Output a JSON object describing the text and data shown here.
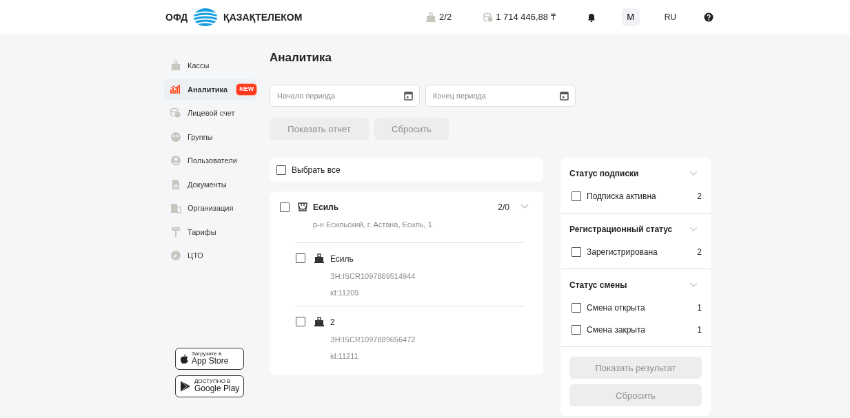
{
  "header": {
    "logo_prefix": "ОФД",
    "logo_brand": "ҚАЗАҚТЕЛЕКОМ",
    "kkm_count": "2/2",
    "balance": "1 714 446,88 ₸",
    "avatar": "M",
    "language": "RU"
  },
  "sidebar": {
    "items": [
      {
        "label": "Кассы",
        "selected": false
      },
      {
        "label": "Аналитика",
        "selected": true,
        "badge": "NEW"
      },
      {
        "label": "Лицевой счет",
        "selected": false
      },
      {
        "label": "Группы",
        "selected": false
      },
      {
        "label": "Пользователи",
        "selected": false
      },
      {
        "label": "Документы",
        "selected": false
      },
      {
        "label": "Организация",
        "selected": false
      },
      {
        "label": "Тарифы",
        "selected": false
      },
      {
        "label": "ЦТО",
        "selected": false
      }
    ],
    "store_badges": [
      {
        "caption": "Загрузите в",
        "name": "App Store"
      },
      {
        "caption": "ДОСТУПНО В",
        "name": "Google Play"
      }
    ]
  },
  "page_title": "Аналитика",
  "period": {
    "start": {
      "placeholder": "Начало периода"
    },
    "end": {
      "placeholder": "Конец периода"
    }
  },
  "report_buttons": [
    {
      "label": "Показать отчет",
      "disabled": true
    },
    {
      "label": "Сбросить",
      "disabled": true
    }
  ],
  "select_all": {
    "label": "Выбрать все",
    "checked": false
  },
  "groups": [
    {
      "name": "Есиль",
      "address": "р-н Есильский, г. Астана, Есиль, 1",
      "count": "2/0",
      "checked": false,
      "children": [
        {
          "name": "Есиль",
          "serial": "ЗН:ISCR1097869514944",
          "id": "id:11209",
          "checked": false
        },
        {
          "name": "2",
          "serial": "ЗН:ISCR1097889656472",
          "id": "id:11211",
          "checked": false
        }
      ]
    }
  ],
  "filters": {
    "sections": [
      {
        "title": "Статус подписки",
        "options": [
          {
            "label": "Подписка активна",
            "count": "2",
            "checked": false
          }
        ]
      },
      {
        "title": "Регистрационный статус",
        "options": [
          {
            "label": "Зарегистрирована",
            "count": "2",
            "checked": false
          }
        ]
      },
      {
        "title": "Статус смены",
        "options": [
          {
            "label": "Смена открыта",
            "count": "1",
            "checked": false
          },
          {
            "label": "Смена закрыта",
            "count": "1",
            "checked": false
          }
        ]
      }
    ],
    "buttons": [
      {
        "label": "Показать результат",
        "disabled": true
      },
      {
        "label": "Сбросить",
        "disabled": true
      }
    ]
  }
}
